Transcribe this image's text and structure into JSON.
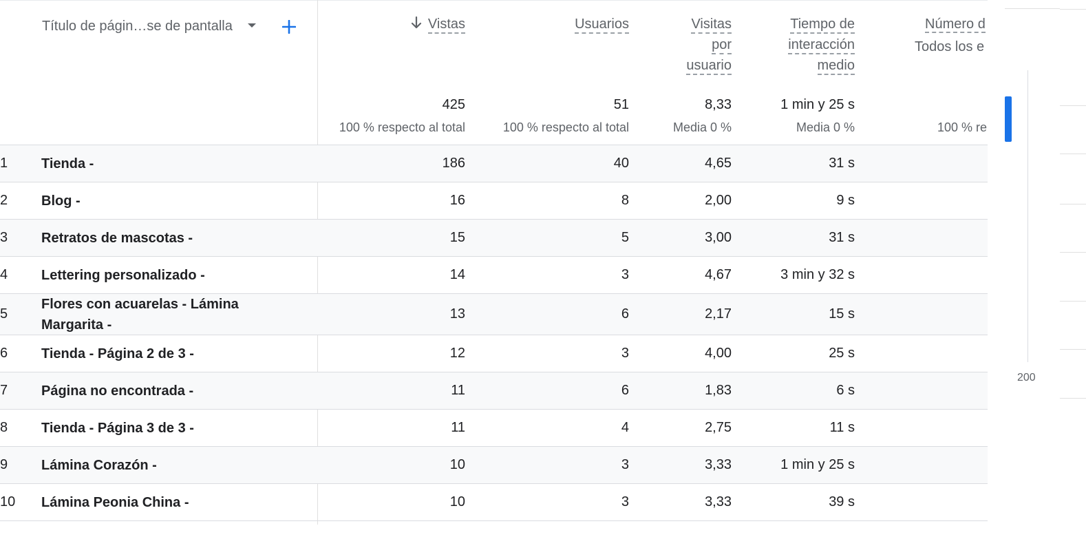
{
  "dimension": {
    "label": "Título de págin…se de pantalla"
  },
  "columns": [
    {
      "key": "views",
      "label_lines": [
        "Vistas"
      ],
      "total": "425",
      "sub": "100 % respecto al total",
      "sorted": true
    },
    {
      "key": "users",
      "label_lines": [
        "Usuarios"
      ],
      "total": "51",
      "sub": "100 % respecto al total"
    },
    {
      "key": "visits_per_user",
      "label_lines": [
        "Visitas",
        "por",
        "usuario"
      ],
      "total": "8,33",
      "sub": "Media 0 %"
    },
    {
      "key": "engagement",
      "label_lines": [
        "Tiempo de",
        "interacción",
        "medio"
      ],
      "total": "1 min y 25 s",
      "sub": "Media 0 %"
    },
    {
      "key": "events",
      "label_lines": [
        "Número d",
        "Todos los e"
      ],
      "total": "",
      "sub": "100 % re"
    }
  ],
  "rows": [
    {
      "index": "1",
      "title": "Tienda -",
      "views": "186",
      "users": "40",
      "visits_per_user": "4,65",
      "engagement": "31 s"
    },
    {
      "index": "2",
      "title": "Blog -",
      "views": "16",
      "users": "8",
      "visits_per_user": "2,00",
      "engagement": "9 s"
    },
    {
      "index": "3",
      "title": "Retratos de mascotas -",
      "views": "15",
      "users": "5",
      "visits_per_user": "3,00",
      "engagement": "31 s"
    },
    {
      "index": "4",
      "title": "Lettering personalizado -",
      "views": "14",
      "users": "3",
      "visits_per_user": "4,67",
      "engagement": "3 min y 32 s"
    },
    {
      "index": "5",
      "title": "Flores con acuarelas - Lámina Margarita -",
      "views": "13",
      "users": "6",
      "visits_per_user": "2,17",
      "engagement": "15 s"
    },
    {
      "index": "6",
      "title": "Tienda - Página 2 de 3 -",
      "views": "12",
      "users": "3",
      "visits_per_user": "4,00",
      "engagement": "25 s"
    },
    {
      "index": "7",
      "title": "Página no encontrada -",
      "views": "11",
      "users": "6",
      "visits_per_user": "1,83",
      "engagement": "6 s"
    },
    {
      "index": "8",
      "title": "Tienda - Página 3 de 3 -",
      "views": "11",
      "users": "4",
      "visits_per_user": "2,75",
      "engagement": "11 s"
    },
    {
      "index": "9",
      "title": "Lámina Corazón -",
      "views": "10",
      "users": "3",
      "visits_per_user": "3,33",
      "engagement": "1 min y 25 s"
    },
    {
      "index": "10",
      "title": "Lámina Peonia China -",
      "views": "10",
      "users": "3",
      "visits_per_user": "3,33",
      "engagement": "39 s"
    }
  ],
  "side_chart": {
    "axis_label": "200"
  },
  "colors": {
    "accent": "#1a73e8",
    "row_shade": "#f8f9fa",
    "divider": "#dadce0"
  }
}
